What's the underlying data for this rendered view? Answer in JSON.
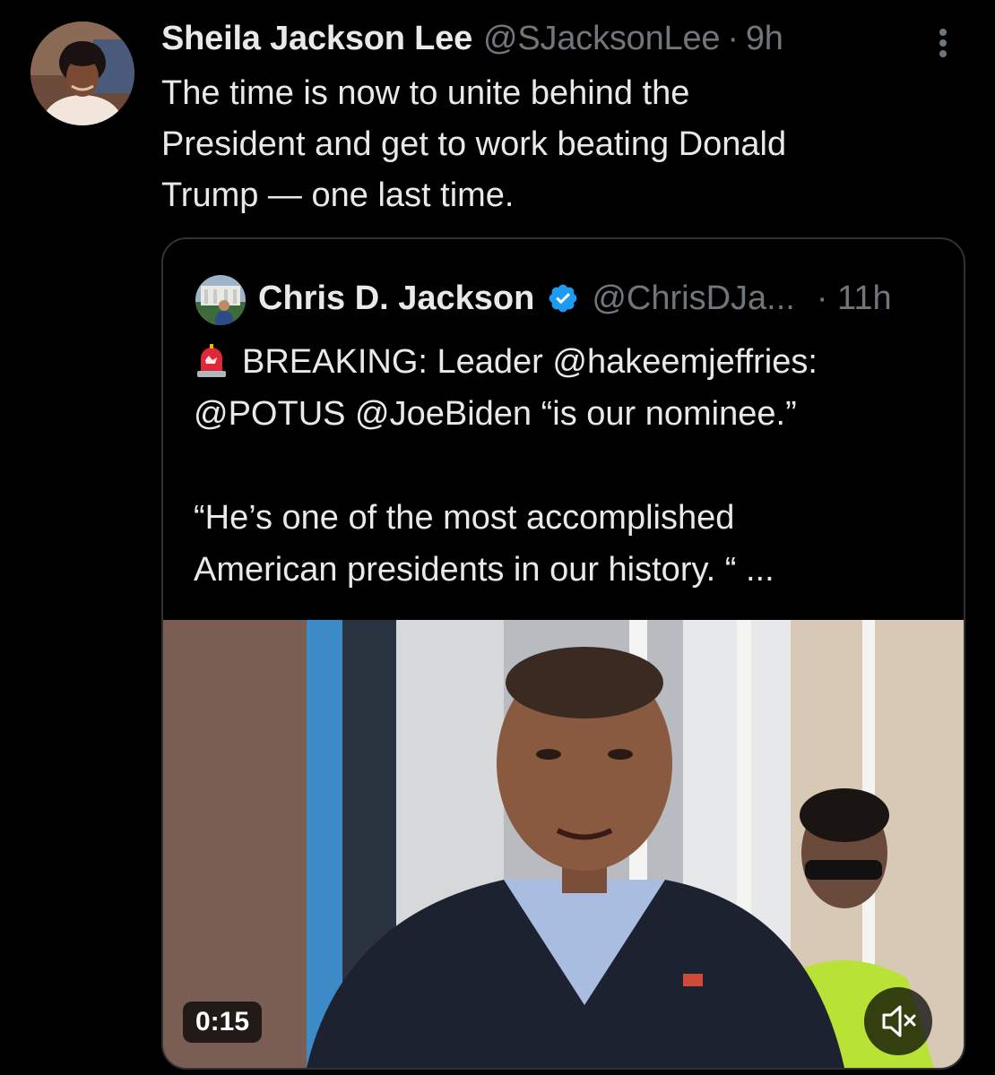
{
  "tweet": {
    "author_name": "Sheila Jackson Lee",
    "author_handle": "@SJacksonLee",
    "separator": "·",
    "time": "9h",
    "text_lines": [
      "The time is now to unite behind the",
      "President and get to work beating Donald",
      "Trump — one last time."
    ],
    "more_icon": "vertical-ellipsis-icon",
    "avatar_icon": "profile-photo"
  },
  "quote": {
    "author_name": "Chris D. Jackson",
    "verified_icon": "verified-badge-icon",
    "author_handle": "@ChrisDJa...",
    "time": "· 11h",
    "siren_icon": "rotating-light-emoji",
    "lines": [
      "BREAKING:  Leader @hakeemjeffries:",
      "@POTUS @JoeBiden “is our nominee.”",
      "",
      "“He’s one of the most accomplished",
      "American presidents in our history. “ ..."
    ],
    "video": {
      "duration": "0:15",
      "mute_icon": "speaker-muted-icon"
    }
  },
  "colors": {
    "background": "#000000",
    "text_primary": "#e7e9ea",
    "text_secondary": "#71767b",
    "border": "#2f3336",
    "verified": "#1d9bf0"
  }
}
